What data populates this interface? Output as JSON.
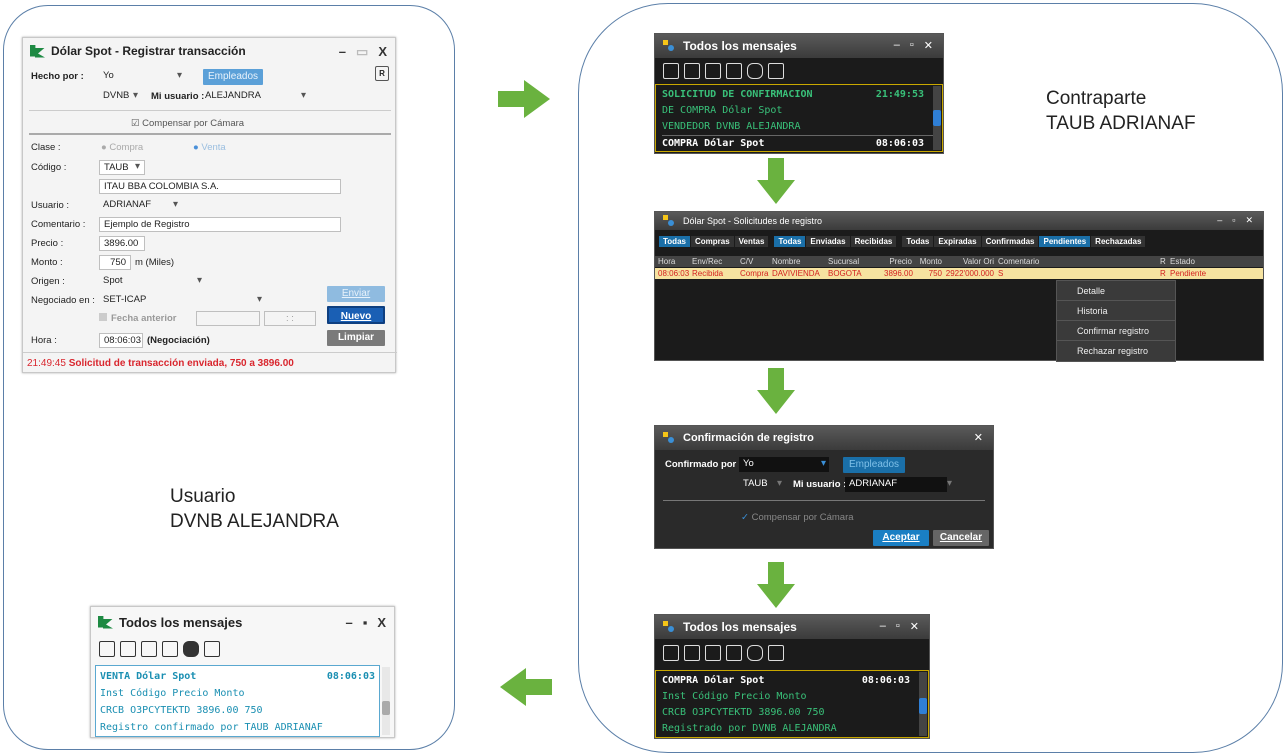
{
  "captions": {
    "left": [
      "Usuario",
      "DVNB ALEJANDRA"
    ],
    "right": [
      "Contraparte",
      "TAUB ADRIANAF"
    ]
  },
  "register_window": {
    "title": "Dólar Spot - Registrar transacción",
    "hecho_por_label": "Hecho por :",
    "hecho_por_value": "Yo",
    "empleados_button": "Empleados",
    "entidad_value": "DVNB",
    "mi_usuario_label": "Mi usuario :",
    "mi_usuario_value": "ALEJANDRA",
    "compensar": "Compensar por Cámara",
    "clase_label": "Clase :",
    "clase_compra": "Compra",
    "clase_venta": "Venta",
    "codigo_label": "Código :",
    "codigo_value": "TAUB",
    "entity_name": "ITAU BBA COLOMBIA S.A.",
    "usuario_label": "Usuario :",
    "usuario_value": "ADRIANAF",
    "comentario_label": "Comentario :",
    "comentario_value": "Ejemplo de Registro",
    "precio_label": "Precio :",
    "precio_value": "3896.00",
    "monto_label": "Monto :",
    "monto_value": "750",
    "monto_unit": "m (Miles)",
    "origen_label": "Origen :",
    "origen_value": "Spot",
    "negociado_label": "Negociado en :",
    "negociado_value": "SET-ICAP",
    "fecha_anterior": "Fecha anterior",
    "time_placeholder": ": :",
    "enviar_button": "Enviar",
    "nuevo_button": "Nuevo",
    "limpiar_button": "Limpiar",
    "hora_label": "Hora :",
    "hora_value": "08:06:03",
    "hora_note": "(Negociación)",
    "status_time": "21:49:45",
    "status_text": "Solicitud de transacción enviada, 750  a 3896.00"
  },
  "msg_top": {
    "title": "Todos los mensajes",
    "lines": [
      {
        "text": "SOLICITUD DE CONFIRMACION",
        "time": "21:49:53",
        "bold": true
      },
      {
        "text": "DE COMPRA Dólar Spot",
        "time": "",
        "bold": false
      },
      {
        "text": "VENDEDOR  DVNB ALEJANDRA",
        "time": "",
        "bold": false
      },
      {
        "text": "COMPRA Dólar Spot",
        "time": "08:06:03",
        "bold": true
      }
    ]
  },
  "requests_window": {
    "title": "Dólar Spot - Solicitudes de registro",
    "tabs_a": [
      "Todas",
      "Compras",
      "Ventas"
    ],
    "tabs_b": [
      "Todas",
      "Enviadas",
      "Recibidas"
    ],
    "tabs_c": [
      "Todas",
      "Expiradas",
      "Confirmadas",
      "Pendientes",
      "Rechazadas"
    ],
    "headers": [
      "Hora",
      "Env/Rec",
      "C/V",
      "Nombre",
      "Sucursal",
      "Precio",
      "Monto",
      "Valor Ori",
      "Comentario",
      "R",
      "Estado"
    ],
    "row": [
      "08:06:03",
      "Recibida",
      "Compra",
      "DAVIVIENDA",
      "BOGOTA",
      "3896.00",
      "750",
      "2922'000.000",
      "S",
      "R",
      "Pendiente"
    ],
    "menu": [
      "Detalle",
      "Historia",
      "Confirmar registro",
      "Rechazar registro"
    ]
  },
  "confirm_window": {
    "title": "Confirmación de registro",
    "confirmado_label": "Confirmado por :",
    "confirmado_value": "Yo",
    "empleados_button": "Empleados",
    "entidad_value": "TAUB",
    "mi_usuario_label": "Mi usuario :",
    "mi_usuario_value": "ADRIANAF",
    "compensar": "Compensar por Cámara",
    "aceptar_button": "Aceptar",
    "cancelar_button": "Cancelar"
  },
  "msg_bottom_right": {
    "title": "Todos los mensajes",
    "lines": [
      {
        "text": "COMPRA Dólar Spot",
        "time": "08:06:03",
        "bold": true
      },
      {
        "text": "Inst Código      Precio Monto",
        "time": "",
        "bold": false
      },
      {
        "text": "CRCB O3PCYTEKTD 3896.00    750",
        "time": "",
        "bold": false
      },
      {
        "text": "Registrado por DVNB ALEJANDRA",
        "time": "",
        "bold": false
      }
    ]
  },
  "msg_bottom_left": {
    "title": "Todos los mensajes",
    "lines": [
      {
        "text": "VENTA Dólar Spot",
        "time": "08:06:03",
        "bold": true
      },
      {
        "text": "Inst Código      Precio Monto",
        "time": "",
        "bold": false
      },
      {
        "text": "CRCB O3PCYTEKTD 3896.00    750",
        "time": "",
        "bold": false
      },
      {
        "text": "Registro confirmado por TAUB ADRIANAF",
        "time": "",
        "bold": false
      }
    ]
  },
  "colors": {
    "arrow": "#6ab23f",
    "panel_border": "#5b7fa8",
    "status_red": "#d9262e",
    "message_green": "#39c079",
    "message_teal": "#1a8fb2"
  }
}
